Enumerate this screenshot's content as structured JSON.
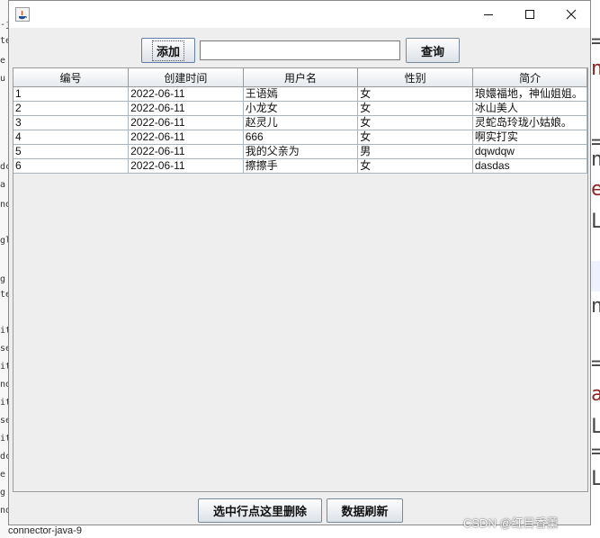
{
  "window": {
    "title": ""
  },
  "toolbar": {
    "add_label": "添加",
    "search_value": "",
    "search_placeholder": "",
    "query_label": "查询"
  },
  "table": {
    "columns": [
      "编号",
      "创建时间",
      "用户名",
      "性别",
      "简介"
    ],
    "rows": [
      [
        "1",
        "2022-06-11",
        "王语嫣",
        "女",
        "琅嬛福地，神仙姐姐。"
      ],
      [
        "2",
        "2022-06-11",
        "小龙女",
        "女",
        "冰山美人"
      ],
      [
        "3",
        "2022-06-11",
        "赵灵儿",
        "女",
        "灵蛇岛玲珑小姑娘。"
      ],
      [
        "4",
        "2022-06-11",
        "666",
        "女",
        "啊实打实"
      ],
      [
        "5",
        "2022-06-11",
        "我的父亲为",
        "男",
        "dqwdqw"
      ],
      [
        "6",
        "2022-06-11",
        "擦擦手",
        "女",
        "dasdas"
      ]
    ]
  },
  "footer": {
    "delete_label": "选中行点这里删除",
    "refresh_label": "数据刷新"
  },
  "background": {
    "bottom_jar": "connector-java-9",
    "left_fragments": [
      "-j",
      "te",
      "e",
      "u",
      "dc",
      "a",
      "no",
      "gl",
      "g",
      "te",
      "it",
      "se",
      "it",
      "no",
      "it",
      "se",
      "it",
      "dc",
      "e",
      "g",
      "no"
    ],
    "right_fragments": [
      "=",
      "n",
      "=",
      "n",
      "e",
      "L",
      "n",
      "=",
      "a",
      "L",
      "=",
      "L"
    ]
  },
  "watermark": "CSDN @红目香薰",
  "colors": {
    "window_bg": "#eeeeee",
    "button_border": "#7a8a99",
    "grid_line": "#a8b4c0"
  }
}
